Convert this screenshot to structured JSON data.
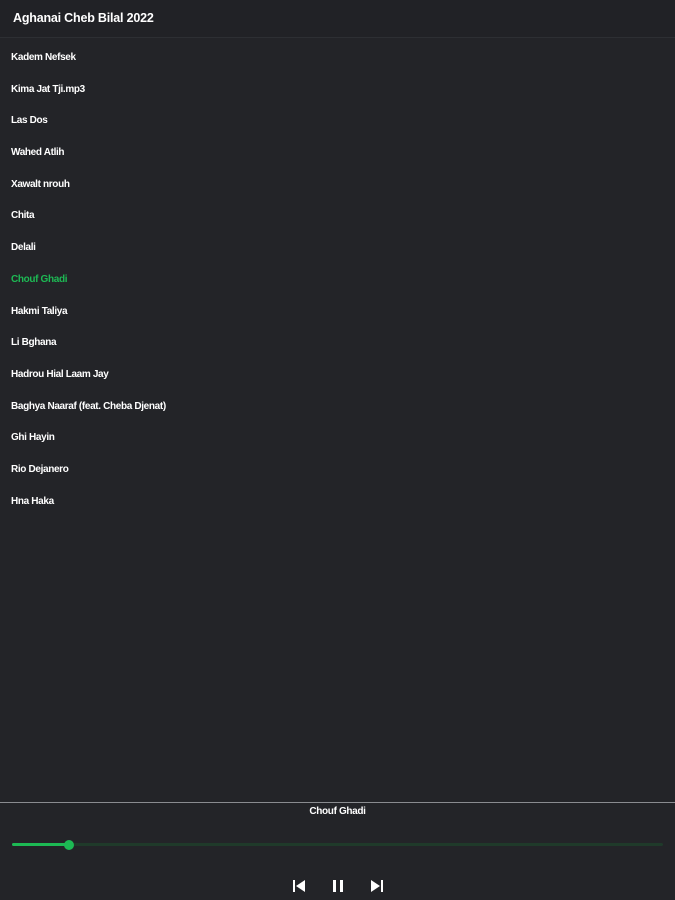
{
  "header": {
    "title": "Aghanai Cheb Bilal 2022"
  },
  "playlist": {
    "tracks": [
      "Kadem Nefsek",
      "Kima Jat Tji.mp3",
      "Las Dos",
      "Wahed Atlih",
      "Xawalt nrouh",
      "Chita",
      "Delali",
      "Chouf Ghadi",
      "Hakmi Taliya",
      "Li Bghana",
      "Hadrou Hial Laam Jay",
      "Baghya Naaraf (feat. Cheba Djenat)",
      "Ghi Hayin",
      "Rio Dejanero",
      "Hna Haka"
    ],
    "active_index": 7
  },
  "player": {
    "now_playing": "Chouf Ghadi",
    "progress": 0.088,
    "controls": {
      "previous_icon": "skip-previous-icon",
      "pause_icon": "pause-icon",
      "next_icon": "skip-next-icon"
    }
  },
  "colors": {
    "background": "#232428",
    "text": "#ffffff",
    "accent": "#1db954",
    "track_remaining": "#1f3a2a"
  }
}
